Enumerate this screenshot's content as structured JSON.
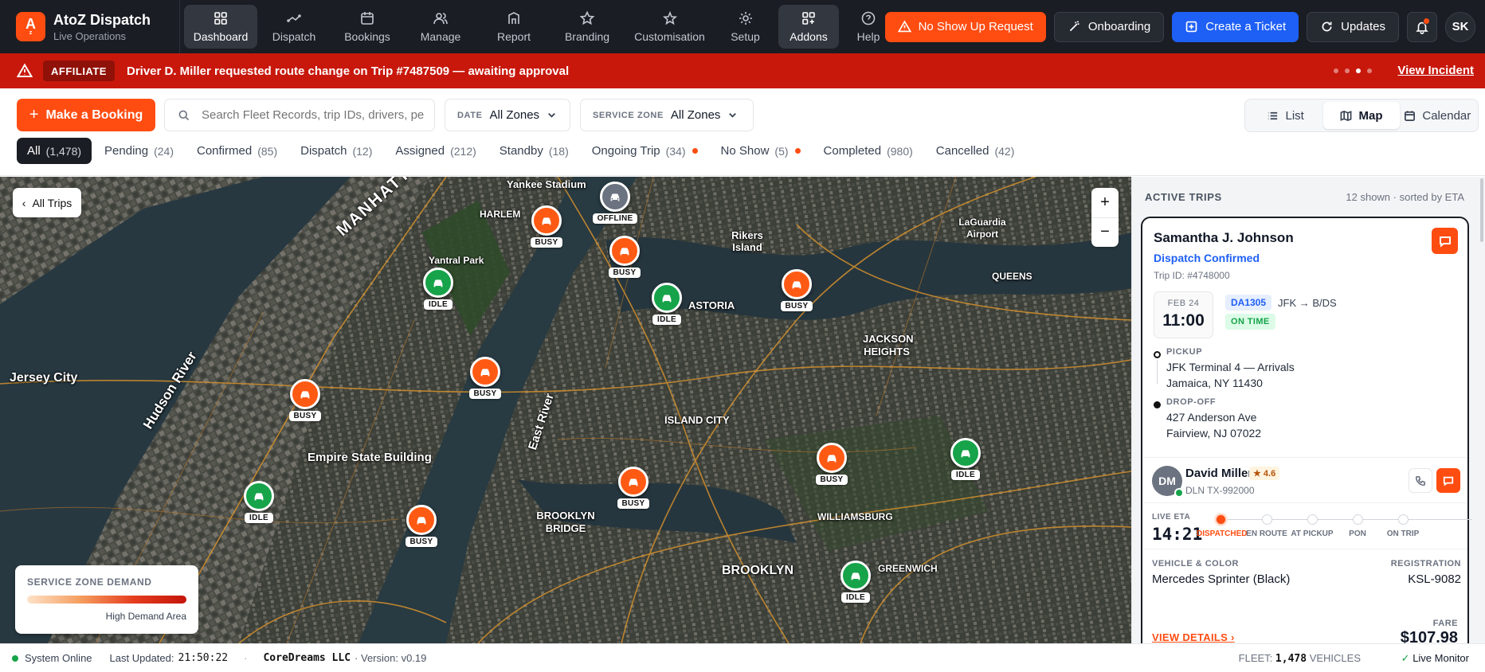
{
  "brand": {
    "logo": "A",
    "logo_sub": "z",
    "title": "AtoZ Dispatch",
    "subtitle": "Live Operations",
    "accent": "#ff4d12"
  },
  "nav": [
    {
      "label": "Dashboard",
      "icon": "grid-icon",
      "active": true
    },
    {
      "label": "Dispatch",
      "icon": "route-icon"
    },
    {
      "label": "Bookings",
      "icon": "calendar-icon"
    },
    {
      "label": "Manage",
      "icon": "users-icon"
    },
    {
      "label": "Report",
      "icon": "report-icon"
    },
    {
      "label": "Branding",
      "icon": "star-icon"
    },
    {
      "label": "Customisation",
      "icon": "star-outline-icon"
    },
    {
      "label": "Setup",
      "icon": "gear-icon"
    },
    {
      "label": "Addons",
      "icon": "addons-icon",
      "active": true
    },
    {
      "label": "Help",
      "icon": "help-icon"
    }
  ],
  "top_actions": {
    "no_show": "No Show Up Request",
    "onboarding": "Onboarding",
    "create_ticket": "Create a Ticket",
    "updates": "Updates",
    "avatar": "SK"
  },
  "alert": {
    "badge": "AFFILIATE",
    "text": "Driver D. Miller requested route change on Trip #7487509 — awaiting approval",
    "link": "View Incident"
  },
  "toolbar": {
    "make_booking": "Make a Booking",
    "search_placeholder": "Search Fleet Records, trip IDs, drivers, pe",
    "date_label": "DATE",
    "date_value": "All Zones",
    "zone_label": "SERVICE ZONE",
    "zone_value": "All Zones",
    "views": [
      "List",
      "Map",
      "Calendar"
    ],
    "active_view": "Map"
  },
  "filters": [
    {
      "label": "All",
      "count": "(1,478)",
      "active": true
    },
    {
      "label": "Pending",
      "count": "(24)"
    },
    {
      "label": "Confirmed",
      "count": "(85)"
    },
    {
      "label": "Dispatch",
      "count": "(12)"
    },
    {
      "label": "Assigned",
      "count": "(212)"
    },
    {
      "label": "Standby",
      "count": "(18)"
    },
    {
      "label": "Ongoing Trip",
      "count": "(34)",
      "dot": true
    },
    {
      "label": "No Show",
      "count": "(5)",
      "dot": true
    },
    {
      "label": "Completed",
      "count": "(980)"
    },
    {
      "label": "Cancelled",
      "count": "(42)"
    }
  ],
  "map": {
    "back": "All Trips",
    "zoom_in": "+",
    "zoom_out": "−",
    "labels": [
      "Yankee Stadium",
      "HARLEM",
      "MANHATTAN",
      "Yantral Park",
      "Rikers Island",
      "LaGuardia Airport",
      "QUEENS",
      "ASTORIA",
      "JACKSON HEIGHTS",
      "Jersey City",
      "Hudson River",
      "Empire State Building",
      "East River",
      "ISLAND CITY",
      "BROOKLYN BRIDGE",
      "BROOKLYN",
      "WILLIAMSBURG",
      "GREENWICH"
    ],
    "pins": [
      {
        "status": "OFFLINE"
      },
      {
        "status": "BUSY"
      },
      {
        "status": "BUSY"
      },
      {
        "status": "IDLE"
      },
      {
        "status": "IDLE"
      },
      {
        "status": "BUSY"
      },
      {
        "status": "BUSY"
      },
      {
        "status": "BUSY"
      },
      {
        "status": "BUSY"
      },
      {
        "status": "IDLE"
      },
      {
        "status": "BUSY"
      },
      {
        "status": "IDLE"
      },
      {
        "status": "BUSY"
      },
      {
        "status": "IDLE"
      }
    ],
    "legend_title": "SERVICE ZONE DEMAND",
    "legend_sub": "High Demand Area"
  },
  "panel": {
    "title": "ACTIVE TRIPS",
    "meta": "12 shown · sorted by ETA",
    "card": {
      "name": "Samantha J. Johnson",
      "status": "Dispatch Confirmed",
      "trip_id": "Trip ID: #4748000",
      "date": "FEB 24",
      "time": "11:00",
      "flight": "DA1305",
      "route": "JFK → B/DS",
      "flight_status": "ON TIME",
      "pickup_label": "PICKUP",
      "pickup_1": "JFK Terminal 4 — Arrivals",
      "pickup_2": "Jamaica, NY 11430",
      "dropoff_label": "DROP-OFF",
      "dropoff_1": "427 Anderson Ave",
      "dropoff_2": "Fairview, NJ 07022",
      "driver_initials": "DM",
      "driver": "David Miller",
      "rating": "★ 4.6",
      "license": "DLN TX-992000",
      "eta_label": "LIVE ETA",
      "eta": "14:21",
      "steps": [
        "DISPATCHED",
        "EN ROUTE",
        "AT PICKUP",
        "PON",
        "ON TRIP"
      ],
      "vehicle_label": "VEHICLE & COLOR",
      "vehicle": "Mercedes Sprinter (Black)",
      "reg_label": "REGISTRATION",
      "reg": "KSL-9082",
      "details": "VIEW DETAILS",
      "fare_label": "FARE",
      "fare": "$107.98"
    }
  },
  "footer": {
    "status": "System Online",
    "updated_label": "Last Updated:",
    "updated": "21:50:22",
    "company": "CoreDreams LLC",
    "version": "· Version: v0.19",
    "fleet_label": "FLEET:",
    "fleet": "1,478",
    "fleet_unit": "VEHICLES",
    "monitor": "Live Monitor"
  }
}
